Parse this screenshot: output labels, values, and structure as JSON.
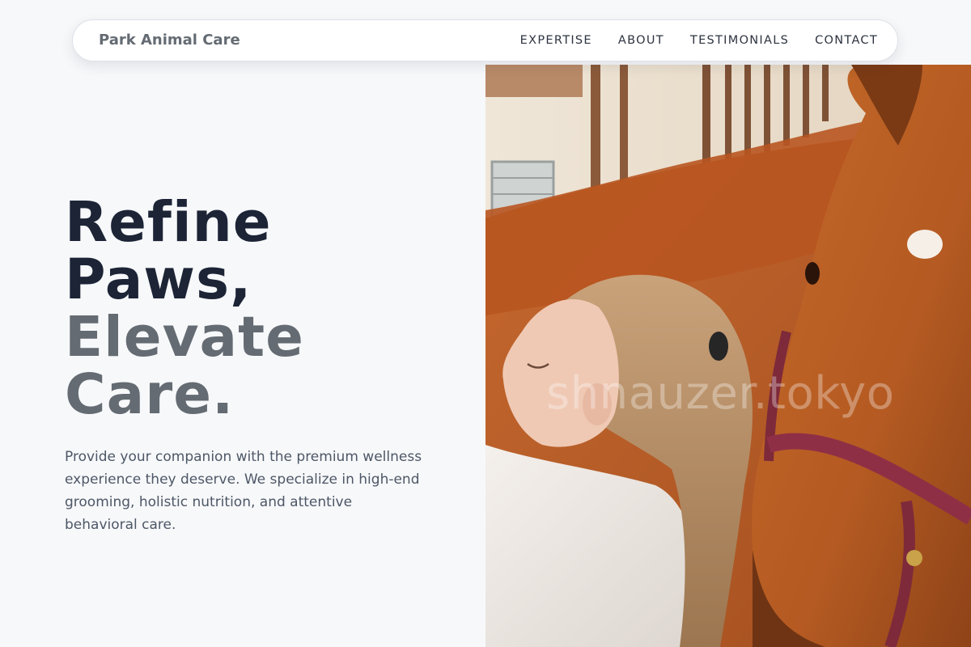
{
  "nav": {
    "brand": "Park Animal Care",
    "links": [
      {
        "label": "EXPERTISE"
      },
      {
        "label": "ABOUT"
      },
      {
        "label": "TESTIMONIALS"
      },
      {
        "label": "CONTACT"
      }
    ]
  },
  "hero": {
    "title_line1": "Refine",
    "title_line2": "Paws,",
    "title_line3": "Elevate",
    "title_line4": "Care.",
    "description": "Provide your companion with the premium wellness experience they deserve. We specialize in high-end grooming, holistic nutrition, and attentive behavioral care.",
    "image": {
      "watermark": "shnauzer.tokyo"
    }
  },
  "colors": {
    "background": "#f7f8fa",
    "heading_dark": "#1c2436",
    "heading_muted": "#646b72",
    "body_text": "#4d5766",
    "nav_text": "#2d3440"
  }
}
